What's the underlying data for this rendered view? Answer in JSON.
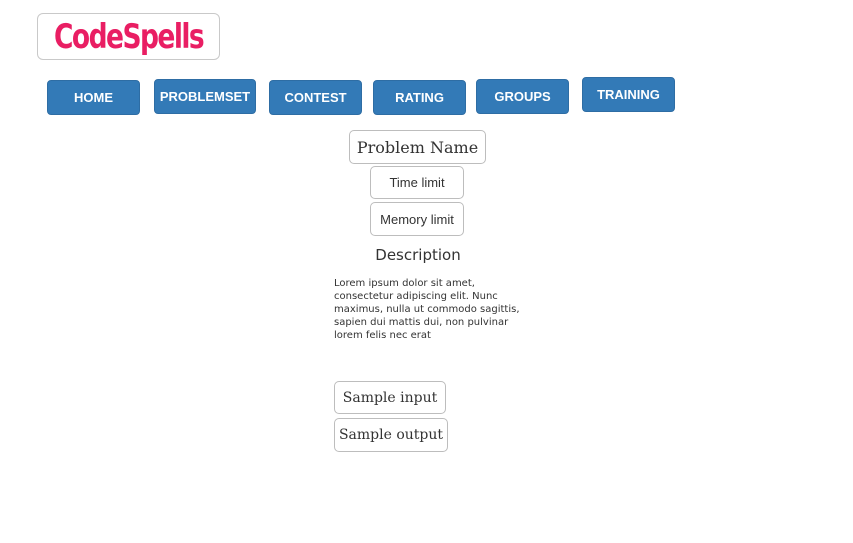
{
  "brand": {
    "logo_text": "CodeSpells"
  },
  "nav": {
    "items": [
      {
        "label": "HOME"
      },
      {
        "label": "PROBLEMSET"
      },
      {
        "label": "CONTEST"
      },
      {
        "label": "RATING"
      },
      {
        "label": "GROUPS"
      },
      {
        "label": "TRAINING"
      }
    ]
  },
  "problem": {
    "name": "Problem Name",
    "time_limit": "Time limit",
    "memory_limit": "Memory limit",
    "description_title": "Description",
    "description_text": "Lorem ipsum dolor sit amet, consectetur adipiscing elit. Nunc maximus, nulla ut commodo sagittis, sapien dui mattis dui, non pulvinar lorem felis nec erat",
    "sample_input": "Sample input",
    "sample_output": "Sample output"
  },
  "colors": {
    "brand_pink": "#e91e63",
    "nav_blue": "#337ab7"
  }
}
